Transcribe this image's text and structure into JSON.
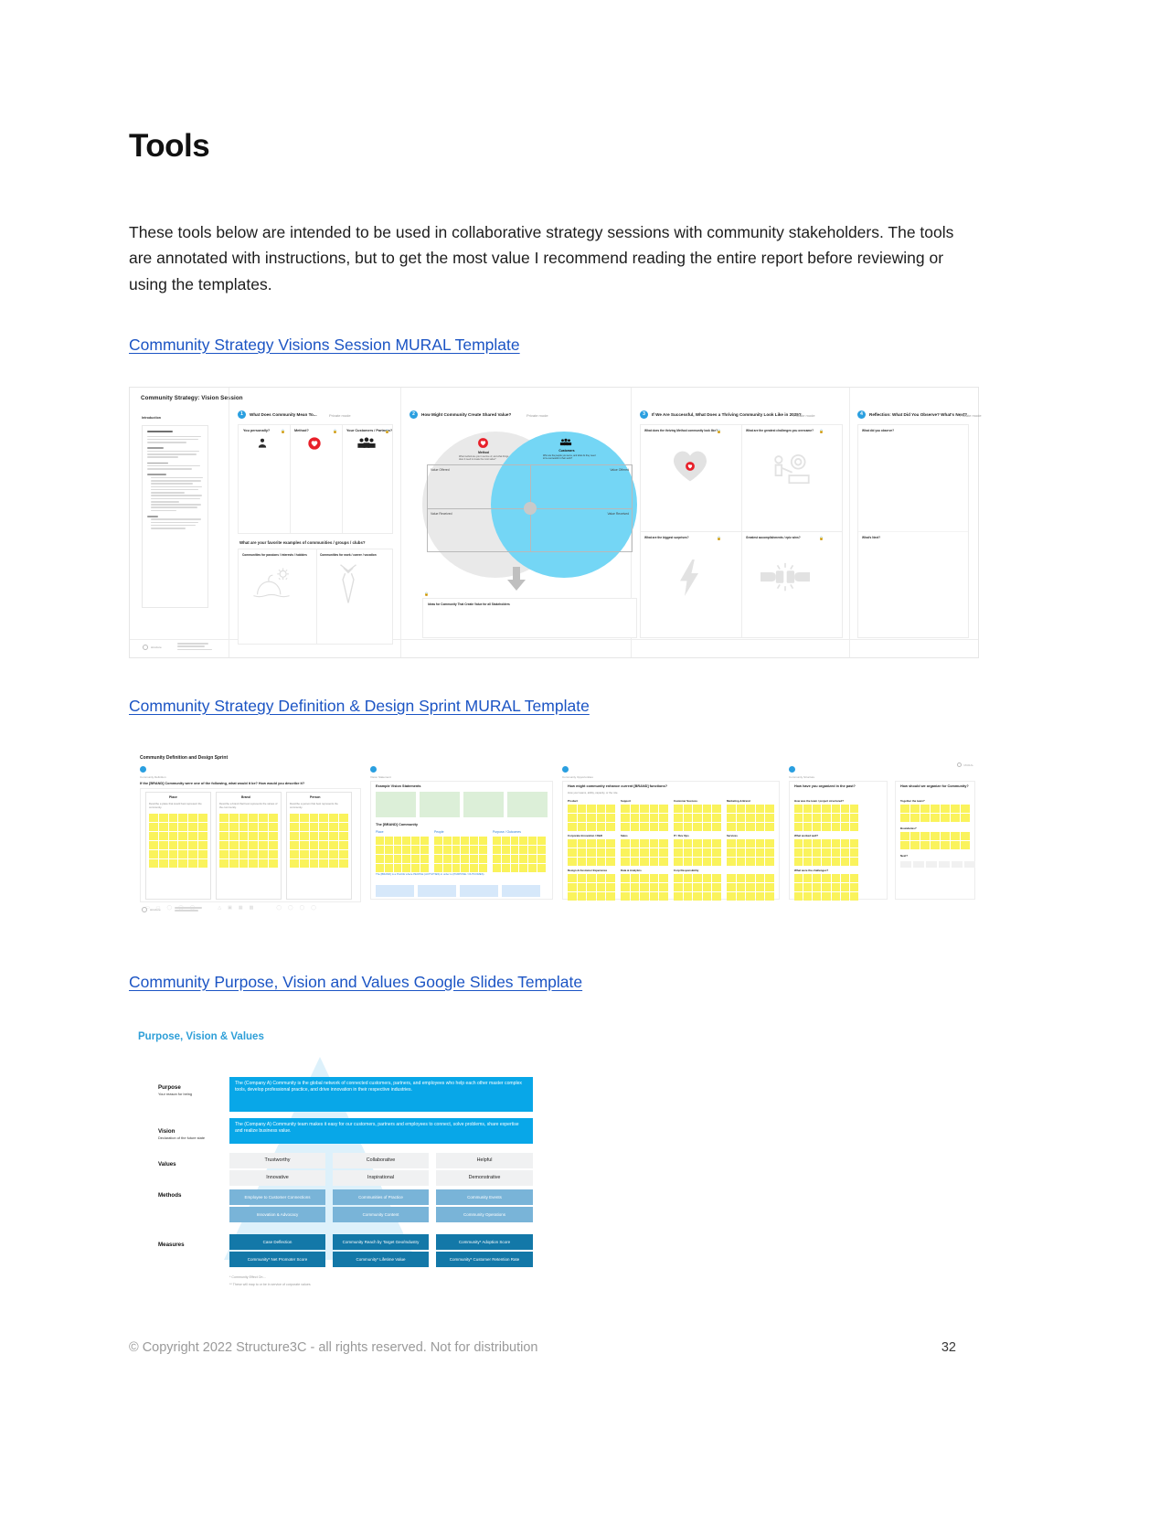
{
  "page": {
    "title": "Tools",
    "intro": "These tools below are intended to be used in collaborative strategy sessions with community stakeholders. The tools are annotated with instructions, but to get the most value I recommend reading the entire report before reviewing or using the templates.",
    "footer_copyright": "© Copyright 2022 Structure3C - all rights reserved. Not for distribution",
    "page_number": "32"
  },
  "links": {
    "link1": "Community Strategy Visions Session MURAL Template",
    "link2": "Community Strategy Definition & Design Sprint MURAL Template",
    "link3": "Community Purpose, Vision and Values Google Slides Template"
  },
  "mural1": {
    "board_title": "Community Strategy: Vision Session",
    "intro_label": "Introduction",
    "intro_sections": [
      "Overview of the Exercise",
      "Timeline",
      "Participants",
      "Facilitation",
      "Notes"
    ],
    "steps": [
      {
        "num": "1",
        "label": "What Does Community Mean To...",
        "lock": "Private mode"
      },
      {
        "num": "2",
        "label": "How Might Community Create Shared Value?",
        "lock": "Private mode"
      },
      {
        "num": "3",
        "label": "If We Are Successful, What Does a Thriving Community Look Like in 2025?",
        "lock": "Private mode"
      },
      {
        "num": "4",
        "label": "Reflection: What Did You Observe? What's Next?",
        "lock": "Private mode"
      }
    ],
    "step1_columns": [
      "You personally?",
      "Method?",
      "Your Customers / Partners?"
    ],
    "step1_icons": [
      "person-icon",
      "heart-icon",
      "group-icon"
    ],
    "step1_question": "What are your favorite examples of communities / groups / clubs?",
    "step1_subcolumns": [
      "Communities for passions / interests / hobbies",
      "Communities for work / career / vocation"
    ],
    "step1_subicons": [
      "beach-umbrella-icon",
      "necktie-icon"
    ],
    "venn": {
      "left_label": "Method",
      "left_icon": "heart-icon",
      "left_desc": "What method are you in service of, and what things does it need to create the most value?",
      "right_label": "Customers",
      "right_icon": "people-icon",
      "right_desc": "Who are the people you serve, and what do they need to be successful in their work?",
      "quadrants": [
        "Value Offered",
        "Value Offered",
        "Value Received",
        "Value Received"
      ],
      "output_label": "Ideas for Community That Create Value for all Stakeholders"
    },
    "step3_cells": [
      {
        "q": "What does the thriving Method community look like?",
        "icon": "heart-icon"
      },
      {
        "q": "What are the greatest challenges you overcame?",
        "icon": "gear-person-icon"
      },
      {
        "q": "What are the biggest surprises?",
        "icon": "lightning-bolt-icon"
      },
      {
        "q": "Greatest accomplishments / epic wins?",
        "icon": "fist-bump-icon"
      }
    ],
    "step4_cells": [
      "What did you observe?",
      "What's Next?"
    ]
  },
  "mural2": {
    "board_title": "Community Definition and Design Sprint",
    "frames": [
      {
        "question": "If the [BRAND] Community were one of the following, what would it be? How would you describe it?",
        "columns": [
          {
            "head": "Place",
            "sub": "Describe a place that would best represent the community."
          },
          {
            "head": "Brand",
            "sub": "Describe a brand that best represents the values of the community."
          },
          {
            "head": "Person",
            "sub": "Describe a person that best represents the community."
          }
        ]
      },
      {
        "question": "Example Vision Statements",
        "sub_question": "The [BRAND] Community",
        "columns": [
          "Place",
          "People",
          "Purpose / Outcomes"
        ],
        "formula": "The [BRAND] is a PLACE where PEOPLE (ACTIVITIES) in order to (PURPOSE / OUTCOMES)."
      },
      {
        "question": "How might community enhance current [BRAND] functions?",
        "sub": "How your teams, ability, capacity, or the role.",
        "columns": [
          "Product",
          "Support",
          "Customer Success",
          "Marketing & Brand",
          "Corporate Innovation / R&D",
          "Sales",
          "IT / Dev Ops",
          "Services",
          "Design & Customer Experience",
          "Data & Analytics",
          "Corp Responsibility"
        ]
      },
      {
        "question": "How have you organized in the past?",
        "columns": [
          "How was the team / project structured?",
          "What worked well?",
          "What were the challenges?"
        ]
      },
      {
        "question": "How should we organize for Community?",
        "columns": [
          "Together the team?",
          "Boundaries?",
          "Next?"
        ]
      }
    ]
  },
  "slide": {
    "title": "Purpose, Vision & Values",
    "rows": [
      {
        "label": "Purpose",
        "sub": "Your reason for being"
      },
      {
        "label": "Vision",
        "sub": "Declaration of the future state"
      },
      {
        "label": "Values",
        "sub": "**"
      },
      {
        "label": "Methods",
        "sub": ""
      },
      {
        "label": "Measures",
        "sub": ""
      }
    ],
    "purpose_text": "The (Company A) Community is the global network of connected customers, partners, and employees who help each other master complex tools, develop professional practice, and drive innovation in their respective industries.",
    "vision_text": "The (Company A) Community team makes it easy for our customers, partners and employees to connect, solve problems, share expertise and realize business value.",
    "values": [
      [
        "Trustworthy",
        "Collaborative",
        "Helpful"
      ],
      [
        "Innovative",
        "Inspirational",
        "Demonstrative"
      ]
    ],
    "methods": [
      [
        "Employee to Customer Connections",
        "Communities of Practice",
        "Community Events"
      ],
      [
        "Innovation & Advocacy",
        "Community Content",
        "Community Operations"
      ]
    ],
    "measures": [
      [
        "Case Deflection",
        "Community Reach by Target Geo/Industry",
        "Community* Adoption Score"
      ],
      [
        "Community* Net Promoter Score",
        "Community* Lifetime Value",
        "Community* Customer Retention Rate"
      ]
    ],
    "footnotes": [
      "* Community Effect On…",
      "** These will map to or be in service of corporate values"
    ],
    "colors": {
      "accent_blue": "#08a7e8",
      "title_blue": "#2e9fd8",
      "methods_blue": "#79b4d8",
      "measures_blue": "#1378a8",
      "values_gray": "#f0f1f2"
    }
  }
}
